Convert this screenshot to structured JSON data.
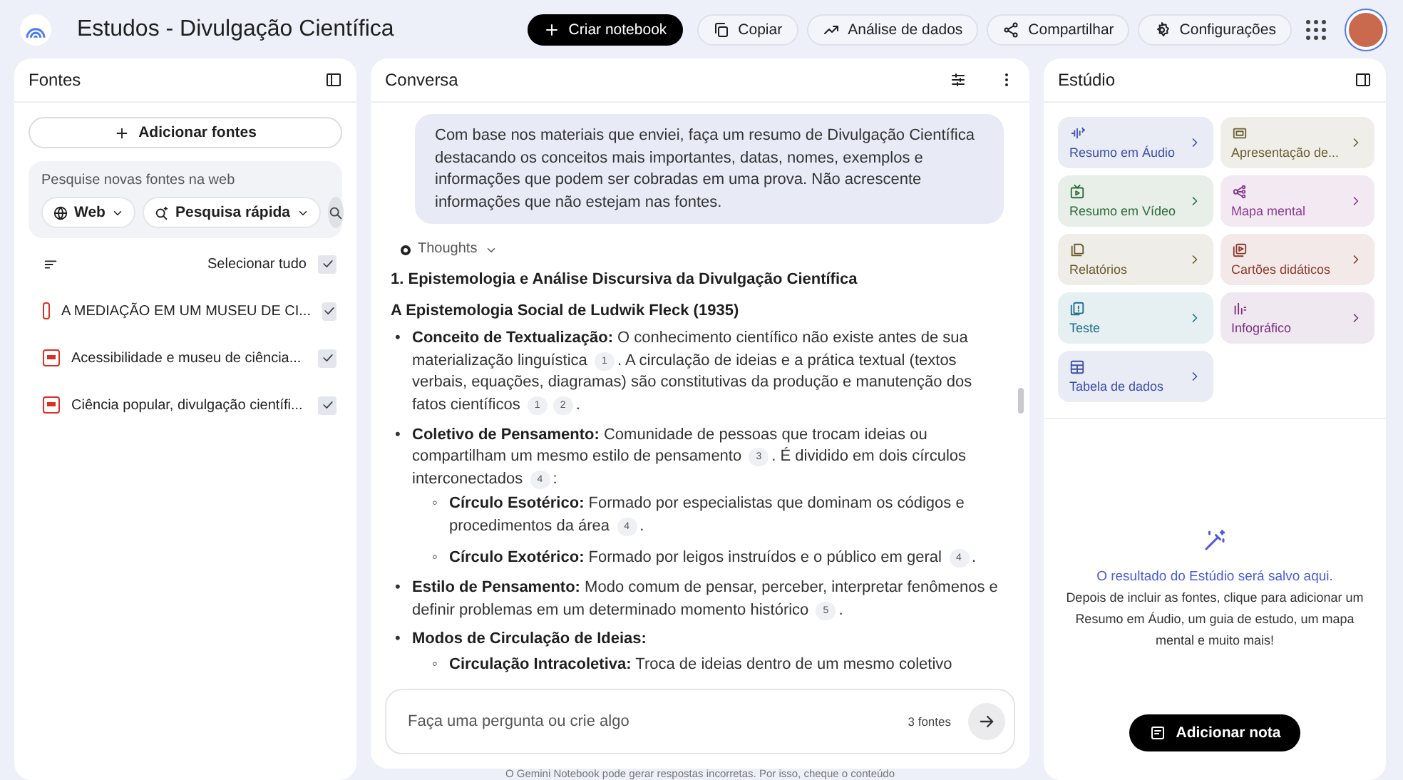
{
  "header": {
    "title": "Estudos - Divulgação Científica",
    "actions": [
      {
        "kind": "create",
        "label": "Criar notebook"
      },
      {
        "kind": "copy",
        "label": "Copiar"
      },
      {
        "kind": "analytics",
        "label": "Análise de dados"
      },
      {
        "kind": "share",
        "label": "Compartilhar"
      },
      {
        "kind": "settings",
        "label": "Configurações"
      }
    ]
  },
  "sources": {
    "title": "Fontes",
    "add_label": "Adicionar fontes",
    "search": {
      "placeholder": "Pesquise novas fontes na web",
      "chips": [
        "Web",
        "Pesquisa rápida"
      ]
    },
    "select_all": {
      "label": "Selecionar tudo",
      "checked": true
    },
    "items": [
      {
        "name": "A MEDIAÇÃO EM UM MUSEU DE CI...",
        "checked": true
      },
      {
        "name": "Acessibilidade e museu de ciência...",
        "checked": true
      },
      {
        "name": "Ciência popular, divulgação científi...",
        "checked": true
      }
    ]
  },
  "chat": {
    "title": "Conversa",
    "prompt": "Com base nos materiais que enviei, faça um resumo de Divulgação Científica destacando os conceitos mais importantes, datas, nomes, exemplos e informações que podem ser cobradas em uma prova. Não acrescente informações que não estejam nas fontes.",
    "thoughts_label": "Thoughts",
    "blocks": [
      {
        "kind": "heading",
        "text": "1. Epistemologia e Análise Discursiva da Divulgação Científica"
      },
      {
        "kind": "subheading",
        "text": "A Epistemologia Social de Ludwik Fleck (1935)"
      },
      {
        "kind": "bullet",
        "marker": "•",
        "term": "Conceito de Textualização:",
        "segments": [
          {
            "text": " O conhecimento científico não existe antes de sua materialização linguística "
          },
          {
            "cite": "1"
          },
          {
            "text": ". A circulação de ideias e a prática textual (textos verbais, equações, diagramas) são constitutivas da produção e manutenção dos fatos científicos "
          },
          {
            "cite": "1"
          },
          {
            "cite": "2"
          },
          {
            "text": "."
          }
        ]
      },
      {
        "kind": "bullet",
        "marker": "•",
        "term": "Coletivo de Pensamento:",
        "segments": [
          {
            "text": " Comunidade de pessoas que trocam ideias ou compartilham um mesmo estilo de pensamento "
          },
          {
            "cite": "3"
          },
          {
            "text": ". É dividido em dois círculos interconectados "
          },
          {
            "cite": "4"
          },
          {
            "text": ":"
          }
        ],
        "children": [
          {
            "marker": "◦",
            "term": "Círculo Esotérico:",
            "segments": [
              {
                "text": " Formado por especialistas que dominam os códigos e procedimentos da área "
              },
              {
                "cite": "4"
              },
              {
                "text": "."
              }
            ]
          },
          {
            "marker": "◦",
            "term": "Círculo Exotérico:",
            "segments": [
              {
                "text": " Formado por leigos instruídos e o público em geral "
              },
              {
                "cite": "4"
              },
              {
                "text": "."
              }
            ]
          }
        ]
      },
      {
        "kind": "bullet",
        "marker": "•",
        "term": "Estilo de Pensamento:",
        "segments": [
          {
            "text": " Modo comum de pensar, perceber, interpretar fenômenos e definir problemas em um determinado momento histórico "
          },
          {
            "cite": "5"
          },
          {
            "text": "."
          }
        ]
      },
      {
        "kind": "bullet",
        "marker": "•",
        "term": "Modos de Circulação de Ideias:",
        "children": [
          {
            "marker": "◦",
            "term": "Circulação Intracoletiva:",
            "segments": [
              {
                "text": " Troca de ideias dentro de um mesmo coletivo"
              }
            ]
          }
        ]
      }
    ],
    "input": {
      "placeholder": "Faça uma pergunta ou crie algo",
      "source_count": "3 fontes"
    },
    "disclaimer": "O Gemini Notebook pode gerar respostas incorretas. Por isso, cheque o conteúdo"
  },
  "studio": {
    "title": "Estúdio",
    "tiles": [
      {
        "kind": "audio",
        "label": "Resumo em Áudio",
        "color": "#3b4fa8"
      },
      {
        "kind": "slides",
        "label": "Apresentação de...",
        "color": "#6b6034"
      },
      {
        "kind": "video",
        "label": "Resumo em Vídeo",
        "color": "#2d6b3b"
      },
      {
        "kind": "mindmap",
        "label": "Mapa mental",
        "color": "#8a3a8e"
      },
      {
        "kind": "report",
        "label": "Relatórios",
        "color": "#6b5a2d"
      },
      {
        "kind": "flashcards",
        "label": "Cartões didáticos",
        "color": "#8a3a2d"
      },
      {
        "kind": "quiz",
        "label": "Teste",
        "color": "#1e6f8a"
      },
      {
        "kind": "infographic",
        "label": "Infográfico",
        "color": "#7a2f7c"
      },
      {
        "kind": "table",
        "label": "Tabela de dados",
        "color": "#3b4fa8"
      }
    ],
    "empty_title": "O resultado do Estúdio será salvo aqui.",
    "empty_text": "Depois de incluir as fontes, clique para adicionar um Resumo em Áudio, um guia de estudo, um mapa mental e muito mais!",
    "note_button": "Adicionar nota"
  }
}
